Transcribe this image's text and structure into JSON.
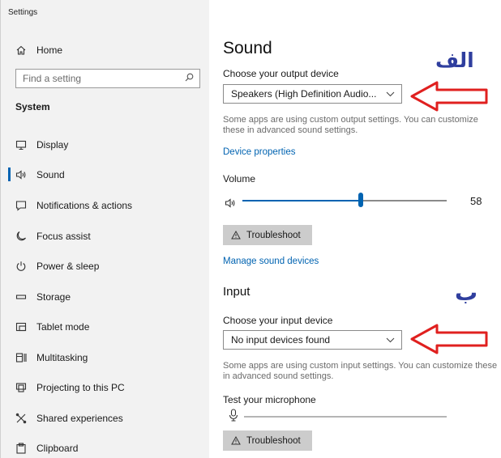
{
  "window": {
    "title": "Settings"
  },
  "sidebar": {
    "home": "Home",
    "search_placeholder": "Find a setting",
    "section": "System",
    "items": [
      {
        "label": "Display",
        "icon": "display-icon"
      },
      {
        "label": "Sound",
        "icon": "speaker-icon",
        "active": true
      },
      {
        "label": "Notifications & actions",
        "icon": "notification-icon"
      },
      {
        "label": "Focus assist",
        "icon": "moon-icon"
      },
      {
        "label": "Power & sleep",
        "icon": "power-icon"
      },
      {
        "label": "Storage",
        "icon": "storage-icon"
      },
      {
        "label": "Tablet mode",
        "icon": "tablet-icon"
      },
      {
        "label": "Multitasking",
        "icon": "multitasking-icon"
      },
      {
        "label": "Projecting to this PC",
        "icon": "projector-icon"
      },
      {
        "label": "Shared experiences",
        "icon": "shared-icon"
      },
      {
        "label": "Clipboard",
        "icon": "clipboard-icon"
      }
    ]
  },
  "main": {
    "title": "Sound",
    "output": {
      "label": "Choose your output device",
      "selected": "Speakers (High Definition Audio...",
      "note": "Some apps are using custom output settings. You can customize these in advanced sound settings.",
      "device_properties": "Device properties",
      "volume_label": "Volume",
      "volume": 58,
      "troubleshoot": "Troubleshoot",
      "manage": "Manage sound devices"
    },
    "input": {
      "title": "Input",
      "label": "Choose your input device",
      "selected": "No input devices found",
      "note": "Some apps are using custom input settings. You can customize these in advanced sound settings.",
      "test_label": "Test your microphone",
      "troubleshoot": "Troubleshoot"
    }
  },
  "annotations": {
    "alef": "الف",
    "be": "ب",
    "arrow_color": "#e0201f",
    "letter_color": "#2f3e9e"
  },
  "colors": {
    "accent": "#0063b1",
    "sidebar_bg": "#f2f2f2",
    "button_bg": "#cccccc"
  }
}
